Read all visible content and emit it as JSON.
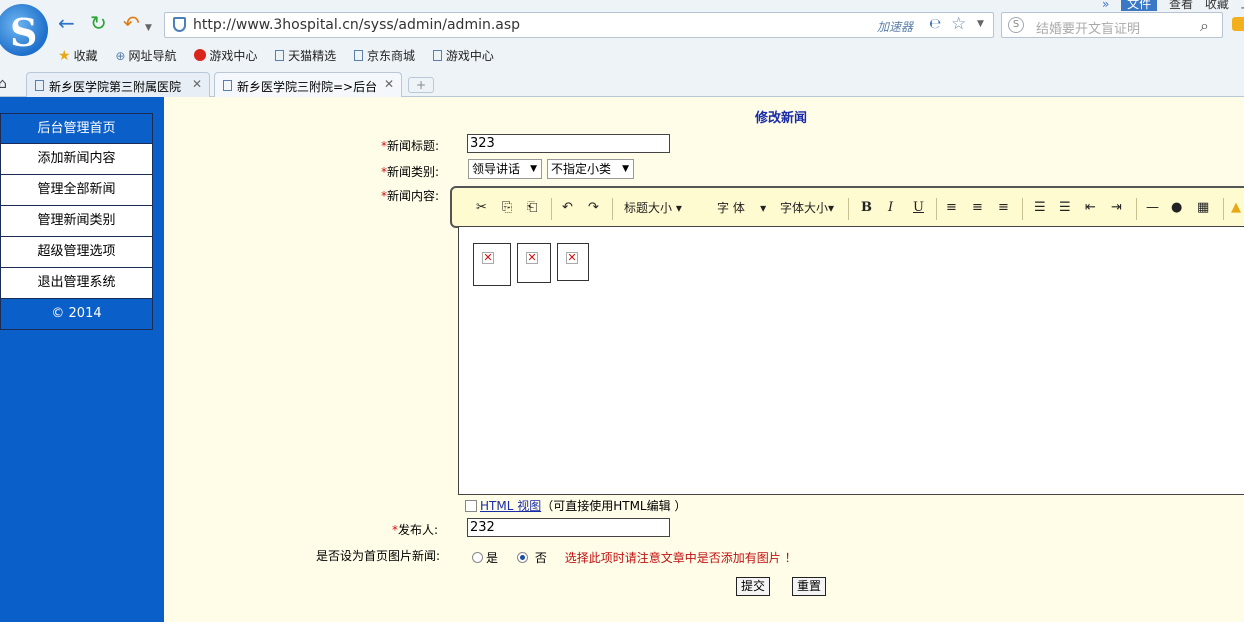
{
  "browser": {
    "url": "http://www.3hospital.cn/syss/admin/admin.asp",
    "accelerator_label": "加速器",
    "search_placeholder": "结婚要开文盲证明",
    "menu": [
      "文件",
      "查看",
      "收藏",
      "工具"
    ],
    "bookmarks": [
      "收藏",
      "网址导航",
      "游戏中心",
      "天猫精选",
      "京东商城",
      "游戏中心"
    ],
    "tabs": [
      {
        "title": "新乡医学院第三附属医院",
        "active": false
      },
      {
        "title": "新乡医学院三附院=>后台",
        "active": true
      }
    ],
    "new_tab_label": "+"
  },
  "nav": {
    "header": "后台管理首页",
    "items": [
      "添加新闻内容",
      "管理全部新闻",
      "管理新闻类别",
      "超级管理选项",
      "退出管理系统"
    ],
    "footer": "© 2014"
  },
  "form": {
    "title": "修改新闻",
    "required_mark": "*",
    "title_label": "新闻标题:",
    "title_value": "323",
    "category_label": "新闻类别:",
    "category_value": "领导讲话",
    "subcategory_value": "不指定小类",
    "content_label": "新闻内容:",
    "toolbar": {
      "heading_size": "标题大小",
      "font": "字 体",
      "font_size": "字体大小",
      "bold": "B",
      "italic": "I",
      "underline": "U"
    },
    "html_view_link": "HTML 视图",
    "html_view_note": "（可直接使用HTML编辑 ）",
    "publisher_label": "发布人:",
    "publisher_value": "232",
    "homepage_label": "是否设为首页图片新闻:",
    "radio_yes": "是",
    "radio_no": "否",
    "radio_selected": "否",
    "radio_note": "选择此项时请注意文章中是否添加有图片 ！",
    "submit_label": "提交",
    "reset_label": "重置"
  },
  "colors": {
    "nav_blue": "#0b5fc9",
    "page_bg": "#fffde8",
    "title_blue": "#1a2ca8",
    "required_red": "#d01010"
  }
}
